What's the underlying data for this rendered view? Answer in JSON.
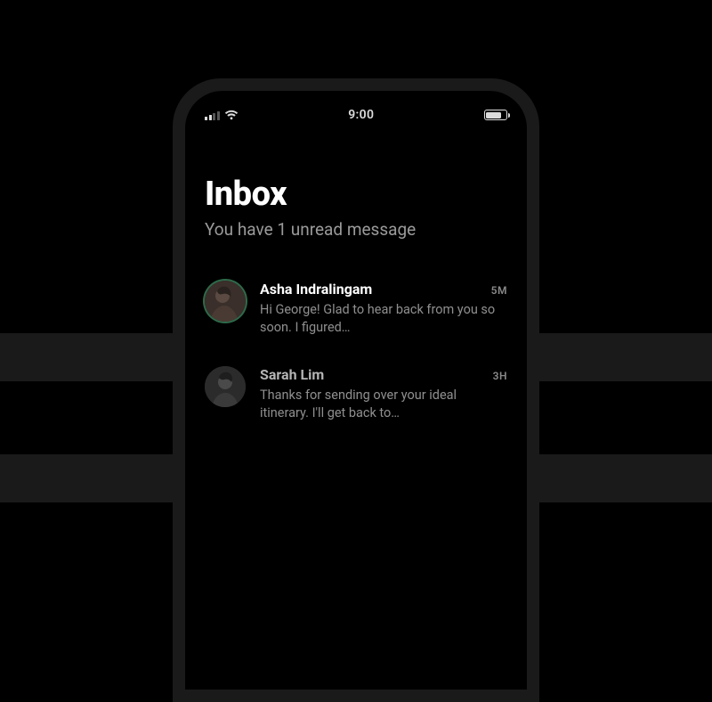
{
  "status": {
    "time": "9:00"
  },
  "header": {
    "title": "Inbox",
    "subtitle": "You have 1 unread message"
  },
  "messages": [
    {
      "name": "Asha Indralingam",
      "time": "5M",
      "preview": "Hi George! Glad to hear back from you so soon. I figured…",
      "unread": true
    },
    {
      "name": "Sarah Lim",
      "time": "3H",
      "preview": "Thanks for sending over your ideal itinerary. I'll get back to…",
      "unread": false
    }
  ]
}
